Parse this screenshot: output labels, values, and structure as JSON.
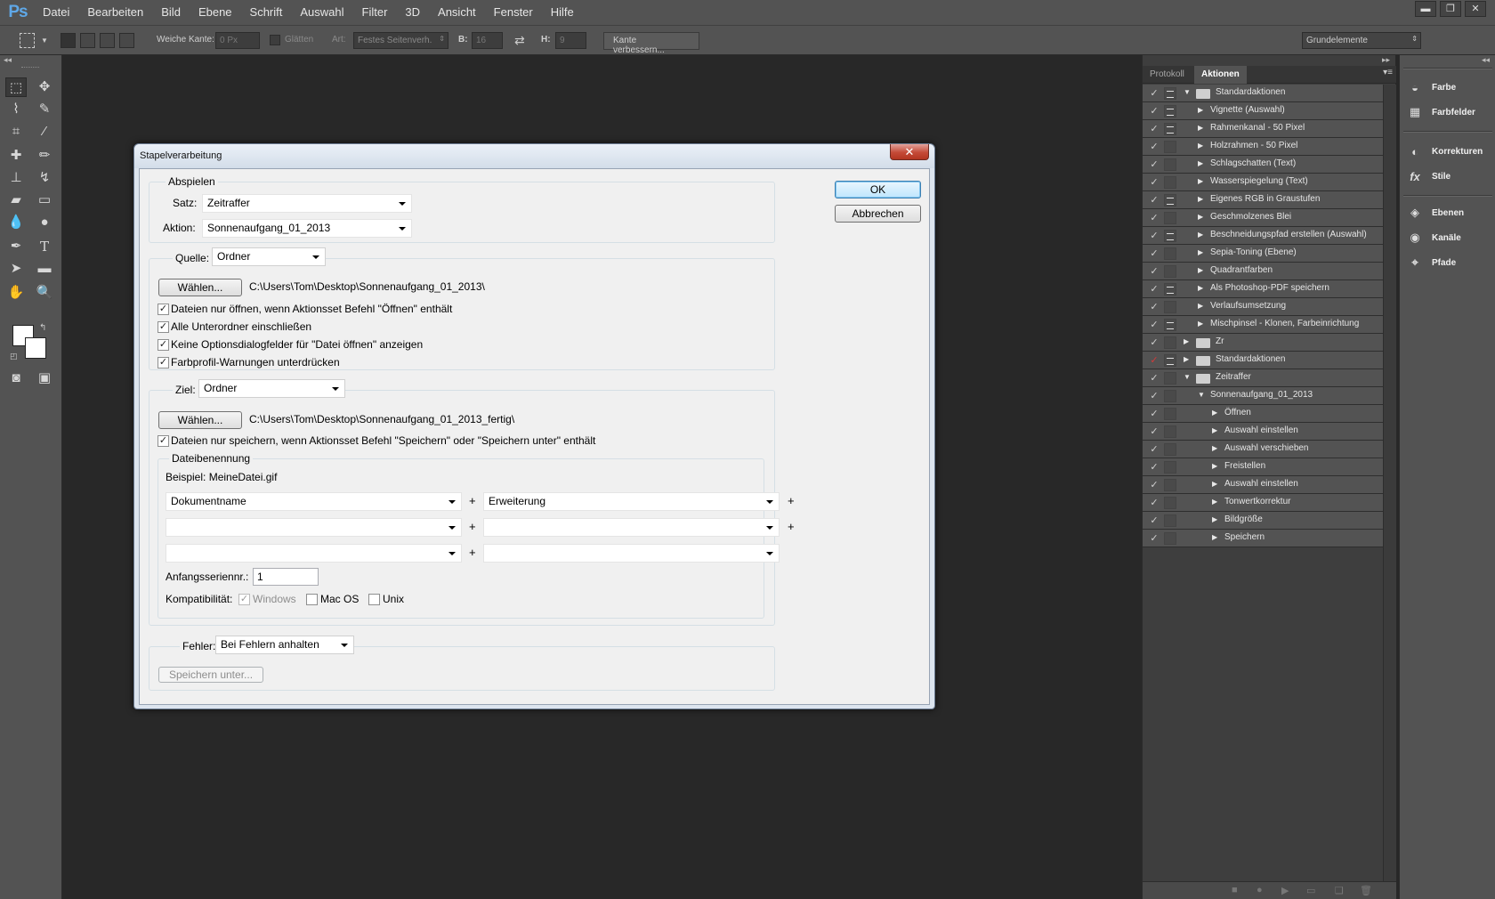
{
  "app": {
    "logo": "Ps"
  },
  "menu": [
    "Datei",
    "Bearbeiten",
    "Bild",
    "Ebene",
    "Schrift",
    "Auswahl",
    "Filter",
    "3D",
    "Ansicht",
    "Fenster",
    "Hilfe"
  ],
  "window_controls": {
    "minimize": "▬",
    "restore": "❐",
    "close": "✕"
  },
  "options_bar": {
    "feather_label": "Weiche Kante:",
    "feather_value": "0 Px",
    "antialias_label": "Glätten",
    "style_label": "Art:",
    "style_value": "Festes Seitenverh.",
    "width_label": "B:",
    "width_value": "16",
    "height_label": "H:",
    "height_value": "9",
    "refine_button": "Kante verbessern...",
    "workspace": "Grundelemente"
  },
  "panel": {
    "tabs": [
      "Protokoll",
      "Aktionen"
    ],
    "active_tab": "Aktionen",
    "actions": [
      {
        "label": "Standardaktionen",
        "level": 0,
        "type": "set",
        "open": true,
        "check": "✓",
        "dialog": true
      },
      {
        "label": "Vignette (Auswahl)",
        "level": 1,
        "type": "action",
        "check": "✓",
        "dialog": true
      },
      {
        "label": "Rahmenkanal - 50 Pixel",
        "level": 1,
        "type": "action",
        "check": "✓",
        "dialog": true
      },
      {
        "label": "Holzrahmen - 50 Pixel",
        "level": 1,
        "type": "action",
        "check": "✓",
        "dialog": false
      },
      {
        "label": "Schlagschatten (Text)",
        "level": 1,
        "type": "action",
        "check": "✓",
        "dialog": false
      },
      {
        "label": "Wasserspiegelung (Text)",
        "level": 1,
        "type": "action",
        "check": "✓",
        "dialog": false
      },
      {
        "label": "Eigenes RGB in Graustufen",
        "level": 1,
        "type": "action",
        "check": "✓",
        "dialog": true
      },
      {
        "label": "Geschmolzenes Blei",
        "level": 1,
        "type": "action",
        "check": "✓",
        "dialog": false
      },
      {
        "label": "Beschneidungspfad erstellen (Auswahl)",
        "level": 1,
        "type": "action",
        "check": "✓",
        "dialog": true
      },
      {
        "label": "Sepia-Toning (Ebene)",
        "level": 1,
        "type": "action",
        "check": "✓",
        "dialog": false
      },
      {
        "label": "Quadrantfarben",
        "level": 1,
        "type": "action",
        "check": "✓",
        "dialog": false
      },
      {
        "label": "Als Photoshop-PDF speichern",
        "level": 1,
        "type": "action",
        "check": "✓",
        "dialog": true
      },
      {
        "label": "Verlaufsumsetzung",
        "level": 1,
        "type": "action",
        "check": "✓",
        "dialog": false
      },
      {
        "label": "Mischpinsel - Klonen, Farbeinrichtung",
        "level": 1,
        "type": "action",
        "check": "✓",
        "dialog": true
      },
      {
        "label": "Zr",
        "level": 0,
        "type": "set",
        "open": false,
        "check": "✓",
        "dialog": false
      },
      {
        "label": "Standardaktionen",
        "level": 0,
        "type": "set",
        "open": false,
        "check": "✓",
        "check_red": true,
        "dialog": true
      },
      {
        "label": "Zeitraffer",
        "level": 0,
        "type": "set",
        "open": true,
        "check": "✓",
        "dialog": false
      },
      {
        "label": "Sonnenaufgang_01_2013",
        "level": 1,
        "type": "action",
        "open": true,
        "check": "✓",
        "dialog": false
      },
      {
        "label": "Öffnen",
        "level": 2,
        "type": "step",
        "check": "✓",
        "dialog": false
      },
      {
        "label": "Auswahl einstellen",
        "level": 2,
        "type": "step",
        "check": "✓",
        "dialog": false
      },
      {
        "label": "Auswahl verschieben",
        "level": 2,
        "type": "step",
        "check": "✓",
        "dialog": false
      },
      {
        "label": "Freistellen",
        "level": 2,
        "type": "step",
        "check": "✓",
        "dialog": false
      },
      {
        "label": "Auswahl einstellen",
        "level": 2,
        "type": "step",
        "check": "✓",
        "dialog": false
      },
      {
        "label": "Tonwertkorrektur",
        "level": 2,
        "type": "step",
        "check": "✓",
        "dialog": false
      },
      {
        "label": "Bildgröße",
        "level": 2,
        "type": "step",
        "check": "✓",
        "dialog": false
      },
      {
        "label": "Speichern",
        "level": 2,
        "type": "step",
        "check": "✓",
        "dialog": false
      }
    ]
  },
  "dock": [
    {
      "label": "Farbe",
      "icon": "palette-icon",
      "glyph": "◒"
    },
    {
      "label": "Farbfelder",
      "icon": "swatches-icon",
      "glyph": "▦"
    },
    {
      "label": "Korrekturen",
      "icon": "adjustments-icon",
      "glyph": "◐"
    },
    {
      "label": "Stile",
      "icon": "styles-icon",
      "glyph": "fx"
    },
    {
      "label": "Ebenen",
      "icon": "layers-icon",
      "glyph": "◈"
    },
    {
      "label": "Kanäle",
      "icon": "channels-icon",
      "glyph": "◉"
    },
    {
      "label": "Pfade",
      "icon": "paths-icon",
      "glyph": "⌖"
    }
  ],
  "dialog": {
    "title": "Stapelverarbeitung",
    "close": "✕",
    "ok": "OK",
    "cancel": "Abbrechen",
    "play": {
      "legend": "Abspielen",
      "set_label": "Satz:",
      "set_value": "Zeitraffer",
      "action_label": "Aktion:",
      "action_value": "Sonnenaufgang_01_2013"
    },
    "source": {
      "label": "Quelle:",
      "value": "Ordner",
      "choose": "Wählen...",
      "path": "C:\\Users\\Tom\\Desktop\\Sonnenaufgang_01_2013\\",
      "opts": [
        {
          "label": "Dateien nur öffnen, wenn Aktionsset Befehl \"Öffnen\" enthält",
          "checked": true
        },
        {
          "label": "Alle Unterordner einschließen",
          "checked": true
        },
        {
          "label": "Keine Optionsdialogfelder für \"Datei öffnen\" anzeigen",
          "checked": true
        },
        {
          "label": "Farbprofil-Warnungen unterdrücken",
          "checked": true
        }
      ]
    },
    "target": {
      "label": "Ziel:",
      "value": "Ordner",
      "choose": "Wählen...",
      "path": "C:\\Users\\Tom\\Desktop\\Sonnenaufgang_01_2013_fertig\\",
      "opt": {
        "label": "Dateien nur speichern, wenn Aktionsset Befehl \"Speichern\" oder \"Speichern unter\" enthält",
        "checked": true
      },
      "naming": {
        "legend": "Dateibenennung",
        "example": "Beispiel: MeineDatei.gif",
        "row1_left": "Dokumentname",
        "row1_right": "Erweiterung",
        "plus": "+",
        "serial_label": "Anfangsseriennr.:",
        "serial_value": "1",
        "compat_label": "Kompatibilität:",
        "windows": "Windows",
        "macos": "Mac OS",
        "unix": "Unix"
      }
    },
    "errors": {
      "label": "Fehler:",
      "value": "Bei Fehlern anhalten",
      "save_as": "Speichern unter..."
    }
  }
}
